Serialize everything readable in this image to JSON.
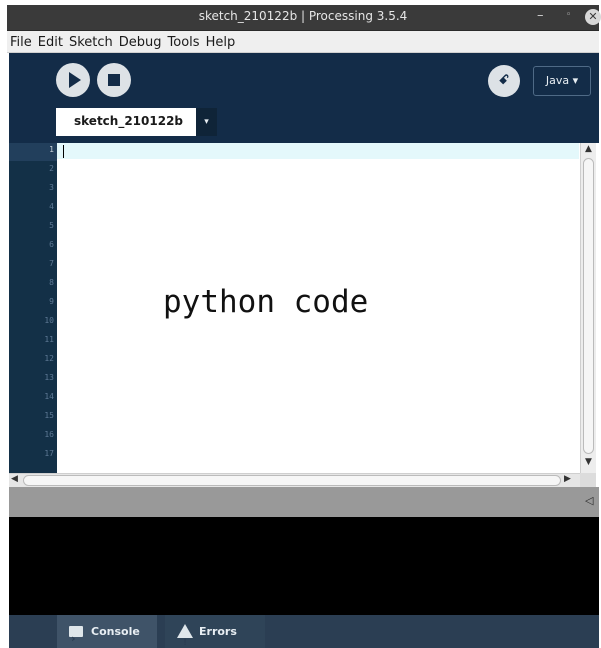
{
  "window": {
    "title": "sketch_210122b | Processing 3.5.4",
    "min_glyph": "–",
    "max_glyph": "◦",
    "close_glyph": "✕"
  },
  "menu": [
    {
      "label": "File"
    },
    {
      "label": "Edit"
    },
    {
      "label": "Sketch"
    },
    {
      "label": "Debug"
    },
    {
      "label": "Tools"
    },
    {
      "label": "Help"
    }
  ],
  "toolbar": {
    "debug_glyph": "ꗃ",
    "mode_label": "Java ▾"
  },
  "tab": {
    "label": "sketch_210122b",
    "menu_glyph": "▾"
  },
  "editor": {
    "line_numbers": [
      "1",
      "2",
      "3",
      "4",
      "5",
      "6",
      "7",
      "8",
      "9",
      "10",
      "11",
      "12",
      "13",
      "14",
      "15",
      "16",
      "17"
    ],
    "overlay_text": "python code"
  },
  "footer": {
    "console_label": "Console",
    "errors_label": "Errors"
  },
  "icons": [
    "run-icon",
    "stop-icon",
    "debug-icon",
    "console-icon",
    "errors-icon"
  ],
  "colors": {
    "toolbar_bg": "#132c48",
    "gutter_bg": "#133047",
    "footer_bg": "#2b3e53"
  }
}
